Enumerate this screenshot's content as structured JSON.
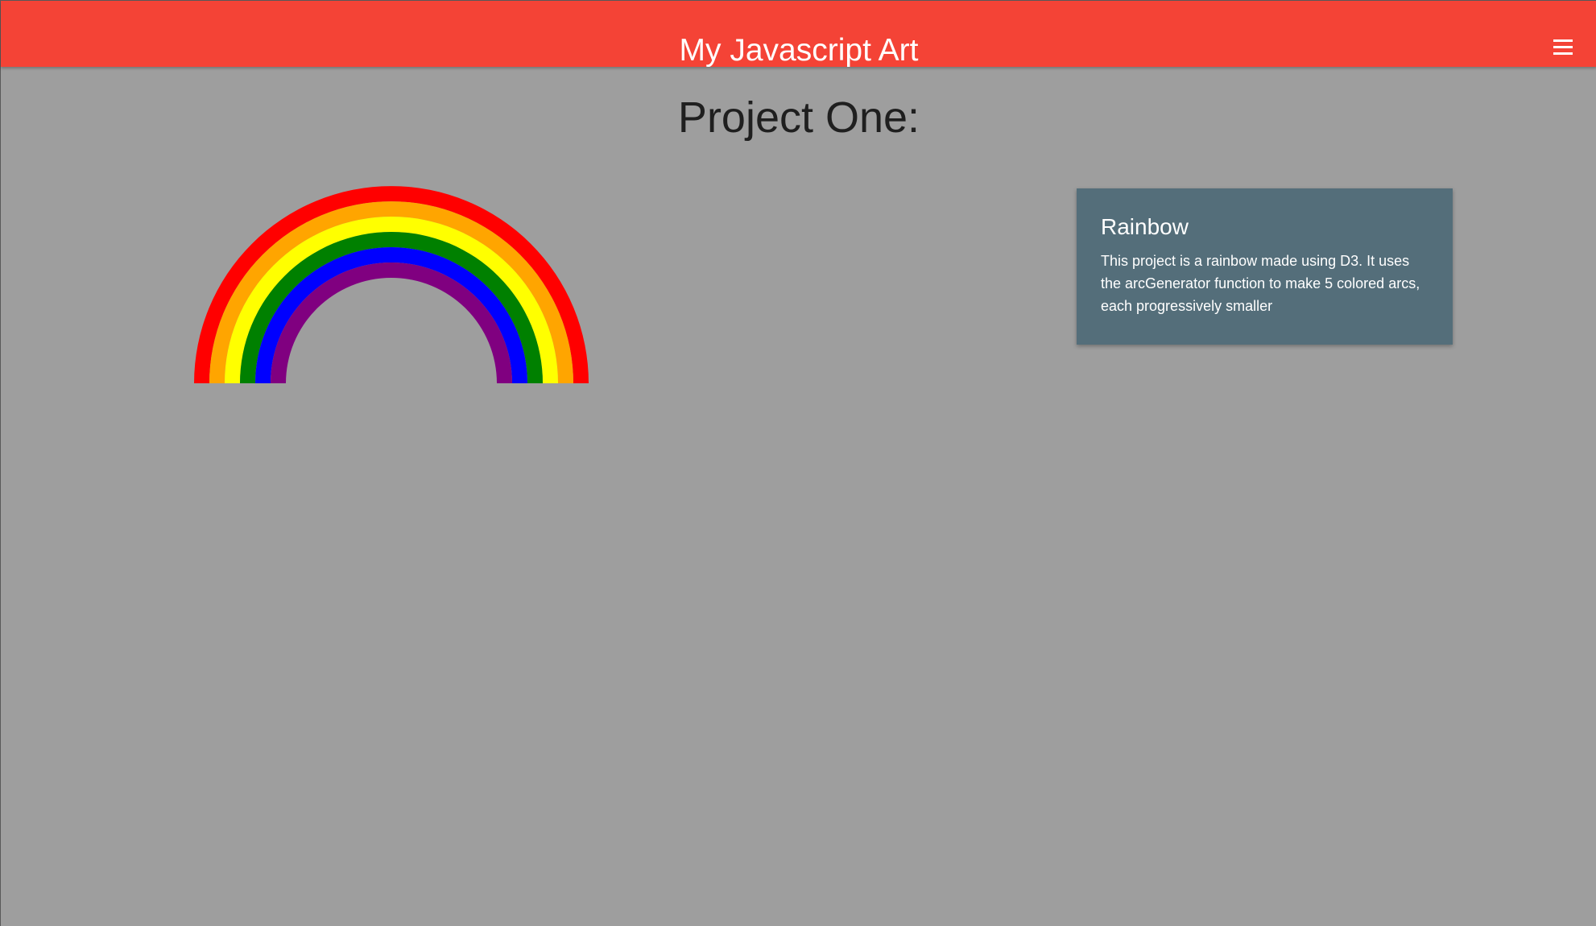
{
  "navbar": {
    "title": "My Javascript Art",
    "menu_icon": "hamburger-menu-icon",
    "color": "#f44336"
  },
  "page": {
    "title": "Project One:",
    "background": "#9e9e9e"
  },
  "rainbow": {
    "colors": [
      "#ff0000",
      "#ffa500",
      "#ffff00",
      "#008000",
      "#0000ff",
      "#800080"
    ]
  },
  "card": {
    "title": "Rainbow",
    "text": "This project is a rainbow made using D3. It uses the arcGenerator function to make 5 colored arcs, each progressively smaller",
    "color": "#546e7a"
  }
}
